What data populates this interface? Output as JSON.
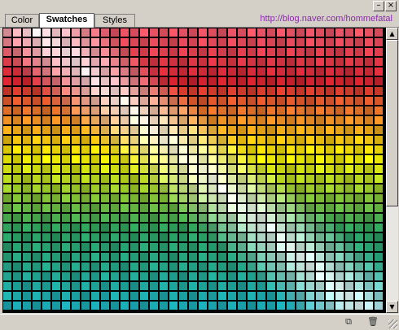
{
  "window": {
    "minimize_icon": "minimize-icon",
    "close_icon": "close-icon"
  },
  "tabs": [
    {
      "label": "Color",
      "active": false
    },
    {
      "label": "Swatches",
      "active": true
    },
    {
      "label": "Styles",
      "active": false
    }
  ],
  "header": {
    "url": "http://blog.naver.com/hommefatal"
  },
  "swatches": {
    "columns": 39,
    "rows": 29,
    "palette_top": "#e05060",
    "palette_red": "#c8202c",
    "palette_orange": "#e27a28",
    "palette_yellow": "#ece400",
    "palette_green": "#2a9858",
    "palette_teal": "#1aa2ac"
  },
  "bottombar": {
    "new_swatch_icon": "new-swatch-icon",
    "delete_swatch_icon": "trash-icon"
  }
}
